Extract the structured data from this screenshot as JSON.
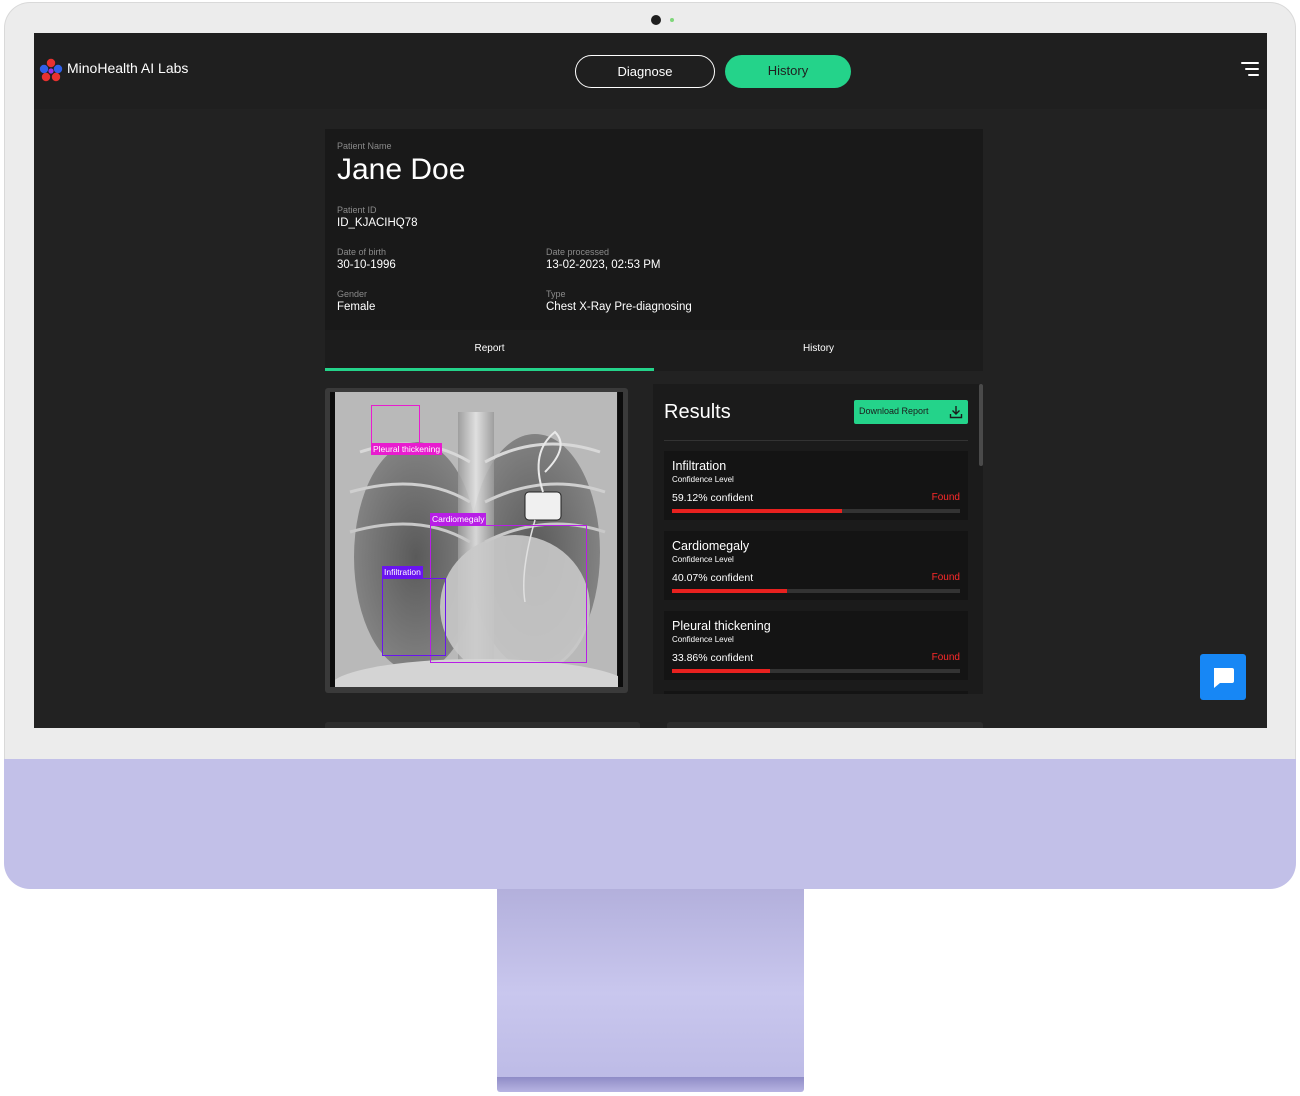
{
  "app": {
    "brand_name": "MinoHealth AI Labs"
  },
  "nav": {
    "diagnose_label": "Diagnose",
    "history_label": "History"
  },
  "patient": {
    "name_label": "Patient Name",
    "name": "Jane Doe",
    "id_label": "Patient ID",
    "id": "ID_KJACIHQ78",
    "dob_label": "Date of birth",
    "dob": "30-10-1996",
    "processed_label": "Date processed",
    "processed": "13-02-2023, 02:53 PM",
    "gender_label": "Gender",
    "gender": "Female",
    "type_label": "Type",
    "type": "Chest X-Ray Pre-diagnosing"
  },
  "tabs": [
    {
      "label": "Report",
      "active": true
    },
    {
      "label": "History",
      "active": false
    }
  ],
  "xray": {
    "annotations": [
      {
        "label": "Pleural thickening",
        "color": "#e81ccf"
      },
      {
        "label": "Cardiomegaly",
        "color": "#b81ee6"
      },
      {
        "label": "Infiltration",
        "color": "#6a14f0"
      }
    ]
  },
  "results": {
    "title": "Results",
    "download_label": "Download Report",
    "items": [
      {
        "name": "Infiltration",
        "sub": "Confidence Level",
        "confidence_text": "59.12% confident",
        "confidence": 59.12,
        "status": "Found"
      },
      {
        "name": "Cardiomegaly",
        "sub": "Confidence Level",
        "confidence_text": "40.07% confident",
        "confidence": 40.07,
        "status": "Found"
      },
      {
        "name": "Pleural thickening",
        "sub": "Confidence Level",
        "confidence_text": "33.86% confident",
        "confidence": 33.86,
        "status": "Found"
      }
    ]
  },
  "colors": {
    "accent": "#24d38a",
    "found": "#ff2a2a",
    "bar": "#e8211f",
    "chat": "#1787f5",
    "chin": "#c2c0e8"
  },
  "icons": {
    "menu": "hamburger-icon",
    "download": "download-icon",
    "chat": "chat-icon",
    "logo": "minohealth-logo"
  }
}
